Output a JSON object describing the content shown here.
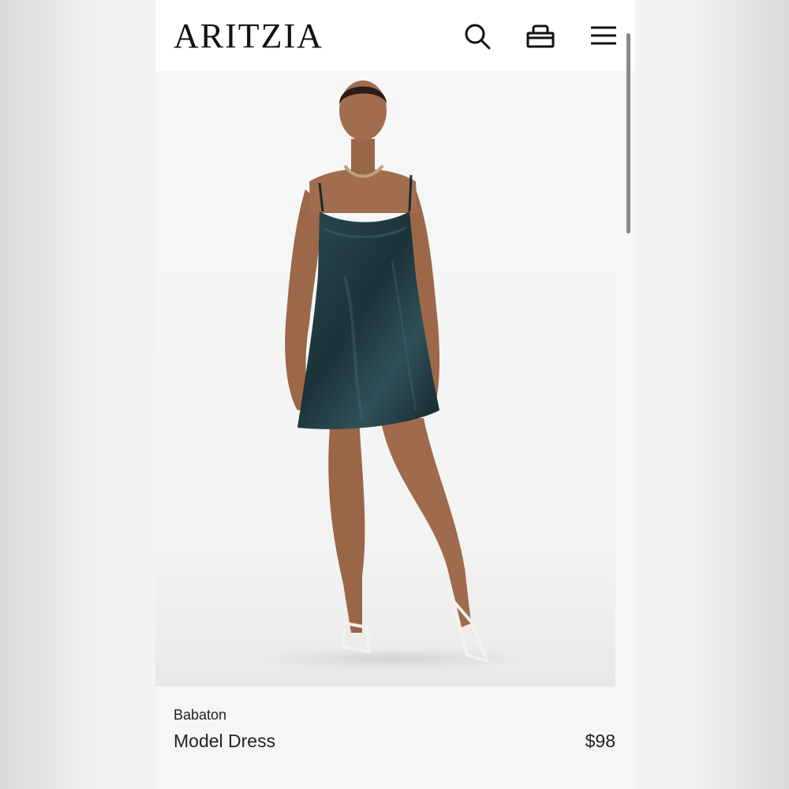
{
  "header": {
    "logo": "ARITZIA",
    "icons": [
      "search-icon",
      "shopping-bag-icon",
      "hamburger-menu-icon"
    ]
  },
  "product": {
    "image_alt": "Model wearing dark teal satin cowl-neck slip mini dress",
    "brand": "Babaton",
    "name": "Model Dress",
    "price": "$98"
  },
  "colors": {
    "header_bg": "#ffffff",
    "page_bg": "#f6f6f6",
    "dress": "#1c3338",
    "text": "#222222"
  }
}
